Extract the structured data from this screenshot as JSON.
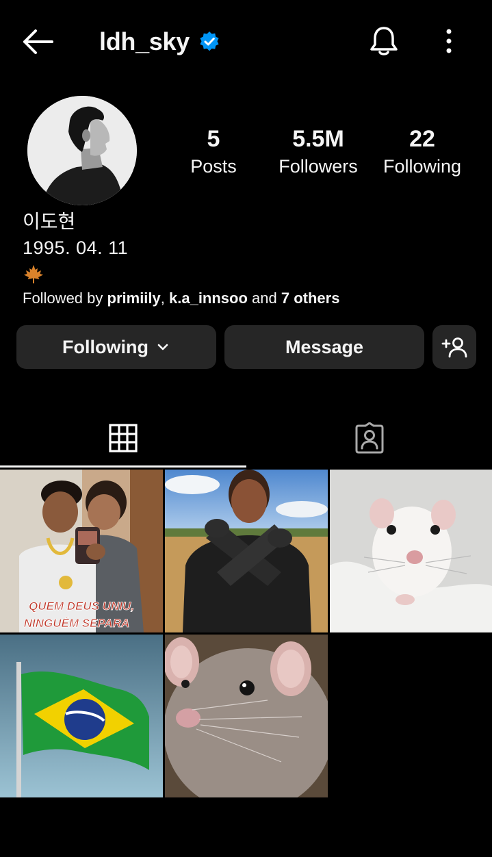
{
  "header": {
    "username": "ldh_sky",
    "verified": true
  },
  "profile": {
    "stats": {
      "posts_count": "5",
      "posts_label": "Posts",
      "followers_count": "5.5M",
      "followers_label": "Followers",
      "following_count": "22",
      "following_label": "Following"
    },
    "full_name": "이도현",
    "birthday": "1995. 04. 11",
    "emoji_icon": "maple-leaf-icon",
    "followed_by": {
      "prefix": "Followed by ",
      "user1": "primiily",
      "sep": ", ",
      "user2": "k.a_innsoo",
      "and_text": " and ",
      "others": "7 others"
    }
  },
  "actions": {
    "following_label": "Following",
    "message_label": "Message"
  },
  "tabs": [
    {
      "name": "posts-grid",
      "icon": "grid-icon",
      "active": true
    },
    {
      "name": "tagged",
      "icon": "tagged-person-icon",
      "active": false
    }
  ],
  "posts": [
    {
      "caption_line1": "QUEM DEUS UNIU,",
      "caption_line2": "NINGUÉM SEPARA"
    },
    {},
    {},
    {},
    {}
  ],
  "colors": {
    "background": "#000000",
    "button": "#262626",
    "verified": "#0095f6",
    "text": "#f5f5f5"
  }
}
